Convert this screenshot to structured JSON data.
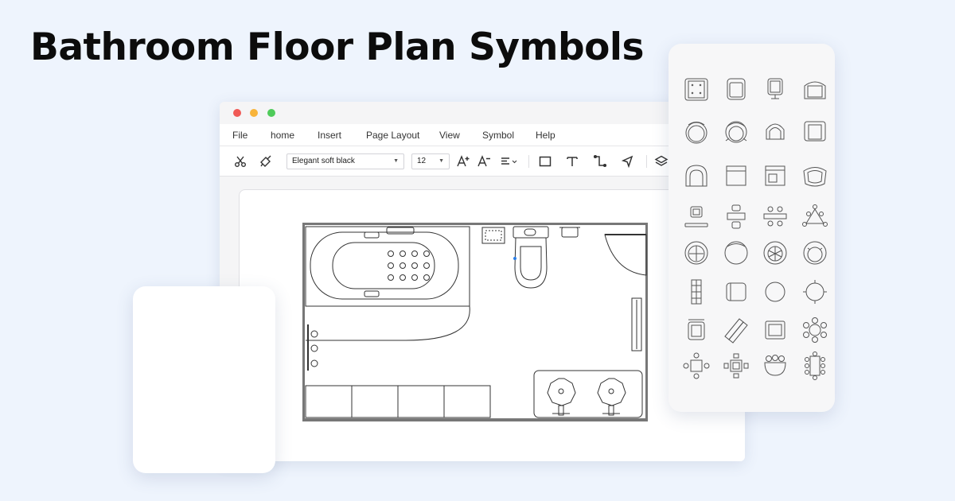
{
  "headline": "Bathroom Floor Plan Symbols",
  "window": {
    "menu": [
      "File",
      "home",
      "Insert",
      "Page Layout",
      "View",
      "Symbol",
      "Help"
    ],
    "toolbar": {
      "font_family_value": "Elegant soft black",
      "font_size_value": "12",
      "tools": [
        "cut-icon",
        "format-painter-icon",
        "font-increase-icon",
        "font-decrease-icon",
        "align-icon",
        "rectangle-icon",
        "text-icon",
        "connector-icon",
        "pointer-icon",
        "layers-icon"
      ]
    }
  },
  "symbol_library": {
    "symbols": [
      "chair-grid-icon",
      "armchair-icon",
      "office-chair-icon",
      "lounge-chair-icon",
      "round-chair-icon",
      "swivel-chair-icon",
      "arched-chair-icon",
      "square-chair-icon",
      "round-back-chair-icon",
      "box-chair-icon",
      "corner-chair-icon",
      "tub-chair-icon",
      "desk-chair-icon",
      "table-two-seat-icon",
      "table-four-seat-icon",
      "triangle-table-icon",
      "round-table-chair-icon",
      "circle-seat-icon",
      "radial-chair-icon",
      "round-armchair-icon",
      "bench-icon",
      "sofa-icon",
      "round-stool-icon",
      "round-seat-icon",
      "recliner-icon",
      "chaise-icon",
      "loveseat-icon",
      "round-table-six-icon",
      "square-table-four-icon",
      "square-table-icon",
      "semicircle-table-icon",
      "conference-table-icon"
    ]
  }
}
